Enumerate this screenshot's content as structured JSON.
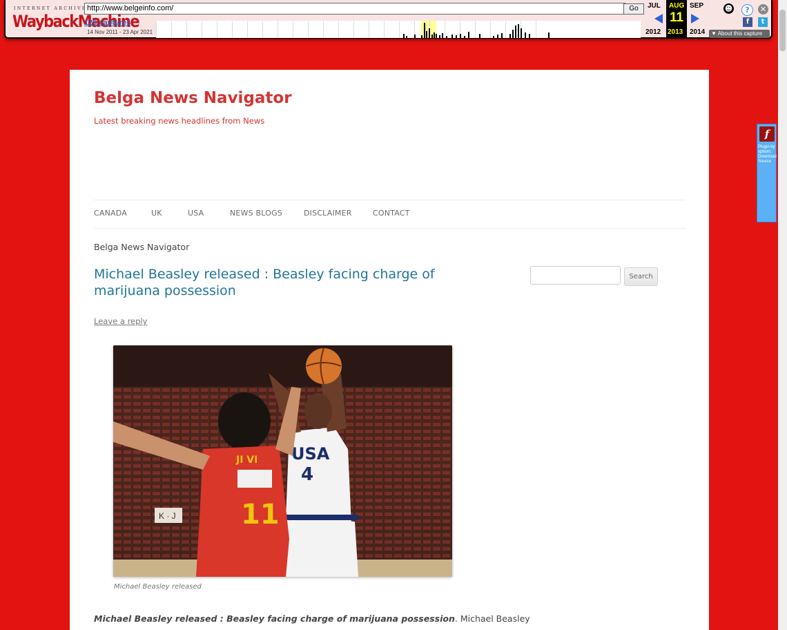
{
  "wayback": {
    "logo_top": "INTERNET ARCHIVE",
    "logo": "WaybackMachine",
    "url": "http://www.belgeinfo.com/",
    "go_label": "Go",
    "captures": "125 captures",
    "range": "14 Nov 2011 - 23 Apr 2021",
    "prev_month": "JUL",
    "cur_month": "AUG",
    "next_month": "SEP",
    "cur_day": "11",
    "prev_year": "2012",
    "cur_year": "2013",
    "next_year": "2014",
    "about": "About this capture"
  },
  "plugin": {
    "text": "Plugin by xpbum. Download Source"
  },
  "site": {
    "title": "Belga News Navigator",
    "description": "Latest breaking news headlines from News"
  },
  "nav": {
    "items": [
      "CANADA",
      "UK",
      "USA",
      "NEWS BLOGS",
      "DISCLAIMER",
      "CONTACT"
    ]
  },
  "breadcrumb": "Belga News Navigator",
  "post": {
    "title": "Michael Beasley released : Beasley facing charge of marijuana possession",
    "leave_reply": "Leave a reply",
    "caption": "Michael Beasley released",
    "lead_bold": "Michael Beasley released : Beasley facing charge of marijuana possession",
    "lead_rest": ". Michael Beasley"
  },
  "search": {
    "placeholder": "",
    "button": "Search"
  },
  "photo": {
    "jersey_red": "11",
    "jersey_white": "4",
    "jersey_white_text": "USA",
    "red_back_text": "JI VI"
  }
}
